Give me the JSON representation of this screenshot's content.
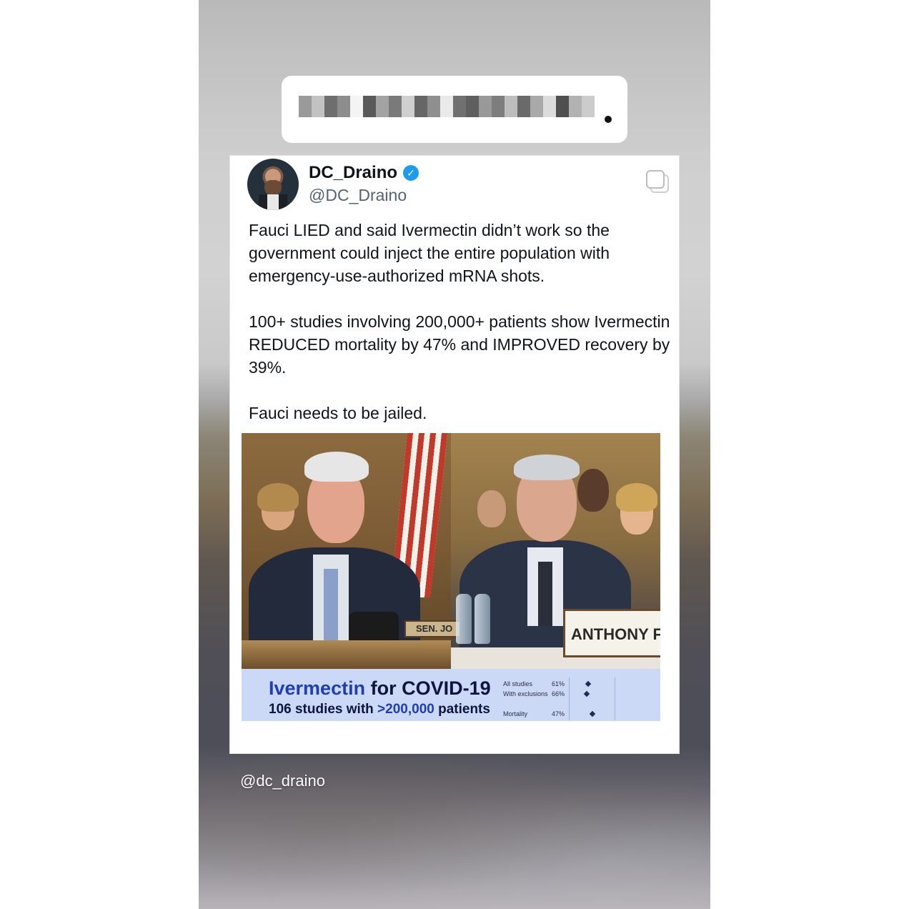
{
  "tweet": {
    "display_name": "DC_Draino",
    "handle": "@DC_Draino",
    "verified_icon": "verified-badge-icon",
    "paragraphs": [
      "Fauci LIED and said Ivermectin didn’t work so the government could inject the entire population with emergency-use-authorized mRNA shots.",
      "100+ studies involving 200,000+ patients show Ivermectin REDUCED mortality by 47% and IMPROVED recovery by 39%.",
      "Fauci needs to be jailed."
    ]
  },
  "media": {
    "placard_right": "ANTHONY FAU",
    "placard_left": "SEN. JO",
    "lower_third": {
      "title_a": "Ivermectin",
      "title_b": " for COVID-19",
      "subtitle_a": "106 studies with ",
      "subtitle_b": ">200,000",
      "subtitle_c": " patients",
      "rows": [
        {
          "label": "All studies",
          "value": "61%"
        },
        {
          "label": "With exclusions",
          "value": "66%"
        },
        {
          "label": "Mortality",
          "value": "47%"
        }
      ]
    }
  },
  "watermark": "@dc_draino",
  "colors": {
    "verified": "#1d9bf0",
    "text": "#0f1419",
    "handle": "#536471",
    "lower_third_bg": "#ccd9f6",
    "lower_third_accent": "#1f3fb0"
  }
}
